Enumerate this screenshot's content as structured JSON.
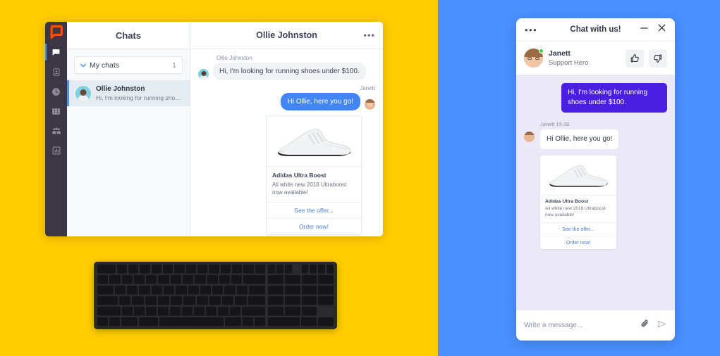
{
  "theme": {
    "left_bg": "#FFCC00",
    "right_bg": "#4A90FF",
    "rail_bg": "#3B3745",
    "accent_blue": "#4285F4",
    "accent_purple": "#4B1FE0",
    "widget_bg": "#EBE9F8",
    "online_green": "#3FCF3F"
  },
  "desktop_app": {
    "rail": {
      "logo_name": "livechat-logo-icon",
      "items": [
        {
          "name": "chats-icon",
          "label": "Chats",
          "active": true
        },
        {
          "name": "contacts-icon",
          "label": "Contacts",
          "active": false
        },
        {
          "name": "archives-clock-icon",
          "label": "Archives",
          "active": false
        },
        {
          "name": "tickets-icon",
          "label": "Tickets",
          "active": false
        },
        {
          "name": "team-icon",
          "label": "Team",
          "active": false
        },
        {
          "name": "reports-chart-icon",
          "label": "Reports",
          "active": false
        }
      ]
    },
    "chats_panel": {
      "header_title": "Chats",
      "group": {
        "label": "My chats",
        "count": "1",
        "chevron_icon": "chevron-down-icon"
      },
      "items": [
        {
          "name": "Ollie Johnston",
          "snippet": "Hi, I'm looking for running shoes...",
          "selected": true
        }
      ]
    },
    "conversation": {
      "title": "Ollie Johnston",
      "more_icon": "ellipsis-horizontal-icon",
      "messages": [
        {
          "author": "Ollie Johnston",
          "direction": "incoming",
          "text": "Hi, I'm looking for running shoes under $100."
        },
        {
          "author": "Janett",
          "direction": "outgoing",
          "text": "Hi Ollie, here you go!"
        }
      ],
      "card": {
        "image_name": "white-running-shoe-image",
        "title": "Adidas Ultra Boost",
        "description": "All white new 2018 Ultraboost now available!",
        "buttons": [
          "See the offer...",
          "Order now!"
        ]
      }
    }
  },
  "keyboard": {
    "name": "magic-keyboard-with-numpad",
    "visible": true
  },
  "chat_widget": {
    "titlebar": {
      "menu_icon": "ellipsis-horizontal-icon",
      "title": "Chat with us!",
      "minimize_icon": "minimize-icon",
      "close_icon": "close-icon"
    },
    "agent": {
      "name": "Janett",
      "role": "Support Hero",
      "status": "online",
      "avatar_name": "janett-avatar",
      "rate_up_icon": "thumbs-up-icon",
      "rate_down_icon": "thumbs-down-icon"
    },
    "messages": [
      {
        "direction": "outgoing",
        "text": "Hi, I'm looking for running shoes under $100."
      },
      {
        "direction": "incoming",
        "meta": "Janett 15:38",
        "text": "Hi Ollie, here you go!"
      }
    ],
    "card": {
      "image_name": "white-running-shoe-image",
      "title": "Adidas Ultra Boost",
      "description": "All white new 2018 Ultraboost now available!",
      "buttons": [
        "See the offer...",
        "Order now!"
      ]
    },
    "composer": {
      "placeholder": "Write a message...",
      "attach_icon": "paperclip-icon",
      "send_icon": "send-paper-plane-icon"
    }
  }
}
